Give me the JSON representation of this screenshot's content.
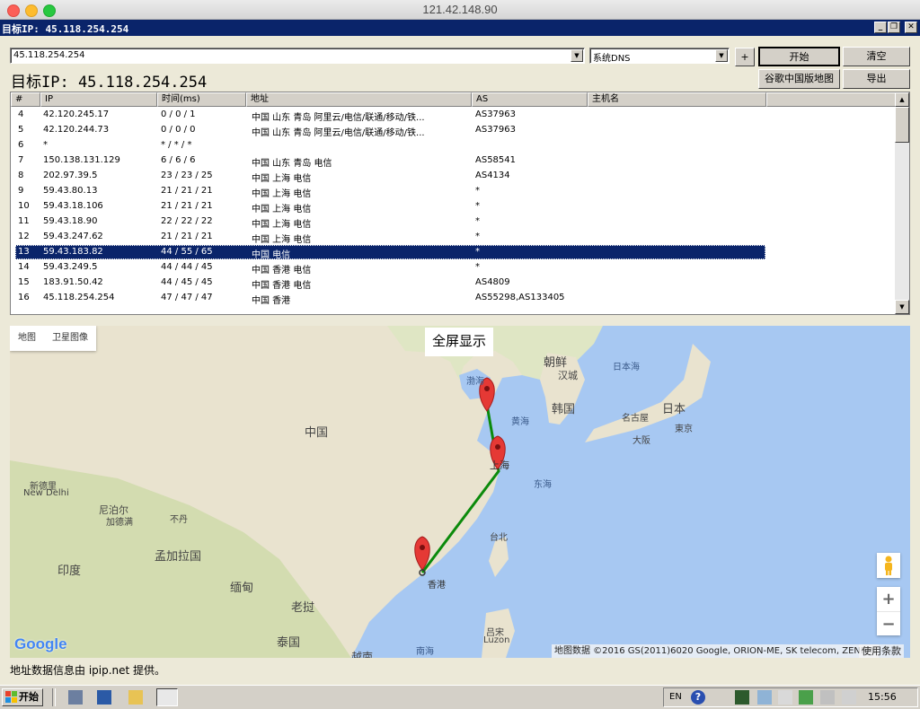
{
  "window": {
    "title": "121.42.148.90"
  },
  "app": {
    "title": "目标IP:  45.118.254.254"
  },
  "toolbar": {
    "target_input": "45.118.254.254",
    "dns_select": "系统DNS",
    "plus_label": "+",
    "start_label": "开始",
    "clear_label": "清空",
    "map_label": "谷歌中国版地图",
    "export_label": "导出",
    "target_heading": "目标IP:  45.118.254.254"
  },
  "columns": [
    "#",
    "IP",
    "时间(ms)",
    "地址",
    "AS",
    "主机名"
  ],
  "rows": [
    {
      "n": "4",
      "ip": "42.120.245.17",
      "time": "0 / 0 / 1",
      "addr": "中国 山东 青岛 阿里云/电信/联通/移动/铁...",
      "as": "AS37963",
      "host": ""
    },
    {
      "n": "5",
      "ip": "42.120.244.73",
      "time": "0 / 0 / 0",
      "addr": "中国 山东 青岛 阿里云/电信/联通/移动/铁...",
      "as": "AS37963",
      "host": ""
    },
    {
      "n": "6",
      "ip": "*",
      "time": "* / * / *",
      "addr": "",
      "as": "",
      "host": ""
    },
    {
      "n": "7",
      "ip": "150.138.131.129",
      "time": "6 / 6 / 6",
      "addr": "中国 山东 青岛 电信",
      "as": "AS58541",
      "host": ""
    },
    {
      "n": "8",
      "ip": "202.97.39.5",
      "time": "23 / 23 / 25",
      "addr": "中国 上海 电信",
      "as": "AS4134",
      "host": ""
    },
    {
      "n": "9",
      "ip": "59.43.80.13",
      "time": "21 / 21 / 21",
      "addr": "中国 上海 电信",
      "as": "*",
      "host": ""
    },
    {
      "n": "10",
      "ip": "59.43.18.106",
      "time": "21 / 21 / 21",
      "addr": "中国 上海 电信",
      "as": "*",
      "host": ""
    },
    {
      "n": "11",
      "ip": "59.43.18.90",
      "time": "22 / 22 / 22",
      "addr": "中国 上海 电信",
      "as": "*",
      "host": ""
    },
    {
      "n": "12",
      "ip": "59.43.247.62",
      "time": "21 / 21 / 21",
      "addr": "中国 上海 电信",
      "as": "*",
      "host": ""
    },
    {
      "n": "13",
      "ip": "59.43.183.82",
      "time": "44 / 55 / 65",
      "addr": "中国 电信",
      "as": "*",
      "host": ""
    },
    {
      "n": "14",
      "ip": "59.43.249.5",
      "time": "44 / 44 / 45",
      "addr": "中国 香港 电信",
      "as": "*",
      "host": ""
    },
    {
      "n": "15",
      "ip": "183.91.50.42",
      "time": "44 / 45 / 45",
      "addr": "中国 香港 电信",
      "as": "AS4809",
      "host": ""
    },
    {
      "n": "16",
      "ip": "45.118.254.254",
      "time": "47 / 47 / 47",
      "addr": "中国 香港",
      "as": "AS55298,AS133405",
      "host": ""
    }
  ],
  "selected_hop": "13",
  "map": {
    "type_map": "地图",
    "type_satellite": "卫星图像",
    "fullscreen": "全屏显示",
    "zoom_in": "+",
    "zoom_out": "−",
    "attribution": "地图数据 ©2016 GS(2011)6020 Google, ORION-ME, SK telecom, ZENRIN",
    "terms": "使用条款",
    "google": "Google",
    "labels": {
      "china": "中国",
      "korea_n": "朝鲜",
      "hanseong": "汉城",
      "korea": "韩国",
      "japan_sea": "日本海",
      "japan": "日本",
      "nagoya": "名古屋",
      "tokyo": "東京",
      "osaka": "大阪",
      "yellow_sea": "黄海",
      "east_sea": "东海",
      "shanghai": "上海",
      "bohai": "渤海",
      "taipei": "台北",
      "hongkong": "香港",
      "south_sea": "南海",
      "luzon_cn": "吕宋",
      "luzon": "Luzon",
      "india": "印度",
      "newdelhi_cn": "新德里",
      "newdelhi": "New Delhi",
      "nepal": "尼泊尔",
      "bhutan": "不丹",
      "bangladesh": "孟加拉国",
      "myanmar": "缅甸",
      "laos": "老挝",
      "thailand": "泰国",
      "vietnam": "越南",
      "edge_left": "尔",
      "kathmandu": "加德满"
    },
    "route_color": "#0b8a0b"
  },
  "footer": "地址数据信息由 ipip.net 提供。",
  "taskbar": {
    "start": "开始",
    "lang": "EN",
    "clock": "15:56"
  }
}
